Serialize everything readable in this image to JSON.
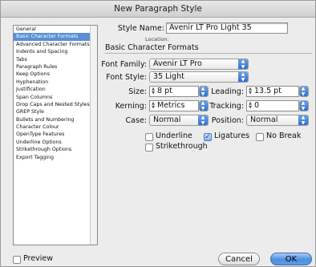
{
  "window": {
    "title": "New Paragraph Style"
  },
  "sidebar": {
    "items": [
      {
        "label": "General",
        "selected": false
      },
      {
        "label": "Basic Character Formats",
        "selected": true
      },
      {
        "label": "Advanced Character Formats",
        "selected": false
      },
      {
        "label": "Indents and Spacing",
        "selected": false
      },
      {
        "label": "Tabs",
        "selected": false
      },
      {
        "label": "Paragraph Rules",
        "selected": false
      },
      {
        "label": "Keep Options",
        "selected": false
      },
      {
        "label": "Hyphenation",
        "selected": false
      },
      {
        "label": "Justification",
        "selected": false
      },
      {
        "label": "Span Columns",
        "selected": false
      },
      {
        "label": "Drop Caps and Nested Styles",
        "selected": false
      },
      {
        "label": "GREP Style",
        "selected": false
      },
      {
        "label": "Bullets and Numbering",
        "selected": false
      },
      {
        "label": "Character Colour",
        "selected": false
      },
      {
        "label": "OpenType Features",
        "selected": false
      },
      {
        "label": "Underline Options",
        "selected": false
      },
      {
        "label": "Strikethrough Options",
        "selected": false
      },
      {
        "label": "Export Tagging",
        "selected": false
      }
    ]
  },
  "form": {
    "style_name_label": "Style Name:",
    "style_name_value": "Avenir LT Pro Light 35",
    "location_label": "Location:",
    "section_title": "Basic Character Formats",
    "font_family_label": "Font Family:",
    "font_family_value": "Avenir LT Pro",
    "font_style_label": "Font Style:",
    "font_style_value": "35 Light",
    "size_label": "Size:",
    "size_value": "8 pt",
    "leading_label": "Leading:",
    "leading_value": "13.5 pt",
    "kerning_label": "Kerning:",
    "kerning_value": "Metrics",
    "tracking_label": "Tracking:",
    "tracking_value": "0",
    "case_label": "Case:",
    "case_value": "Normal",
    "position_label": "Position:",
    "position_value": "Normal",
    "underline_label": "Underline",
    "underline_checked": false,
    "ligatures_label": "Ligatures",
    "ligatures_checked": true,
    "nobreak_label": "No Break",
    "nobreak_checked": false,
    "strikethrough_label": "Strikethrough",
    "strikethrough_checked": false
  },
  "footer": {
    "preview_label": "Preview",
    "preview_checked": false,
    "cancel_label": "Cancel",
    "ok_label": "OK"
  },
  "colors": {
    "accent": "#5a8fd3",
    "default_button": "#4c8fe0"
  }
}
